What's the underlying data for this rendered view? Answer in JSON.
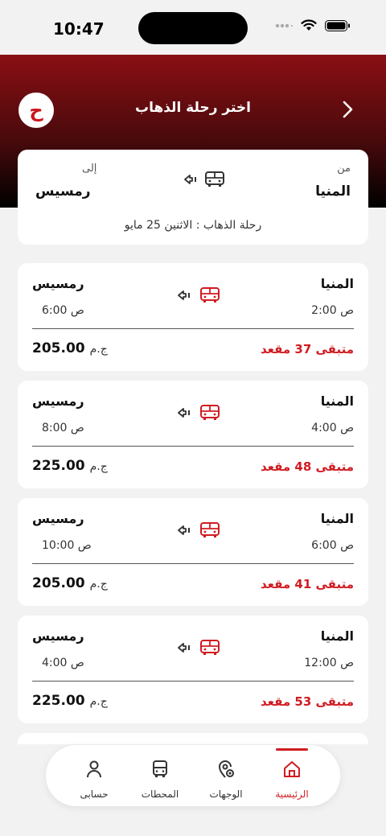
{
  "status": {
    "time": "10:47"
  },
  "header": {
    "title": "اختر رحلة الذهاب",
    "logo_letter": "ح"
  },
  "route": {
    "from_label": "من",
    "from_city": "المنيا",
    "to_label": "إلى",
    "to_city": "رمسيس",
    "date": "رحلة الذهاب : الاثنين 25 مايو"
  },
  "trips": [
    {
      "from_city": "المنيا",
      "from_time": "2:00 ص",
      "to_city": "رمسيس",
      "to_time": "6:00 ص",
      "seats": "متبقى 37 مقعد",
      "price": "205.00",
      "currency": "ج.م"
    },
    {
      "from_city": "المنيا",
      "from_time": "4:00 ص",
      "to_city": "رمسيس",
      "to_time": "8:00 ص",
      "seats": "متبقى 48 مقعد",
      "price": "225.00",
      "currency": "ج.م"
    },
    {
      "from_city": "المنيا",
      "from_time": "6:00 ص",
      "to_city": "رمسيس",
      "to_time": "10:00 ص",
      "seats": "متبقى 41 مقعد",
      "price": "205.00",
      "currency": "ج.م"
    },
    {
      "from_city": "المنيا",
      "from_time": "12:00 ص",
      "to_city": "رمسيس",
      "to_time": "4:00 ص",
      "seats": "متبقى 53 مقعد",
      "price": "225.00",
      "currency": "ج.م"
    }
  ],
  "nav": {
    "home": "الرئيسية",
    "destinations": "الوجهات",
    "stations": "المحطات",
    "account": "حسابى"
  },
  "colors": {
    "accent": "#d01c22",
    "header_top": "#8a0f14"
  }
}
